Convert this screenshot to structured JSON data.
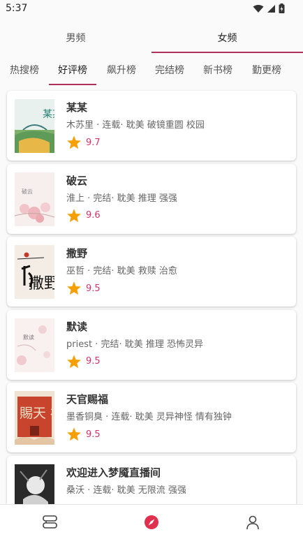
{
  "status_bar": {
    "time": "5:37"
  },
  "gender_tabs": [
    {
      "label": "男频",
      "active": false
    },
    {
      "label": "女频",
      "active": true
    }
  ],
  "rank_tabs": [
    {
      "label": "热搜榜",
      "active": false
    },
    {
      "label": "好评榜",
      "active": true
    },
    {
      "label": "飙升榜",
      "active": false
    },
    {
      "label": "完结榜",
      "active": false
    },
    {
      "label": "新书榜",
      "active": false
    },
    {
      "label": "勤更榜",
      "active": false
    }
  ],
  "books": [
    {
      "title": "某某",
      "meta": "木苏里 · 连载· 耽美 破镜重圆 校园",
      "score": "9.7"
    },
    {
      "title": "破云",
      "meta": "淮上 · 完结· 耽美 推理 强强",
      "score": "9.6"
    },
    {
      "title": "撒野",
      "meta": "巫哲 · 完结· 耽美 救赎 治愈",
      "score": "9.5"
    },
    {
      "title": "默读",
      "meta": "priest · 完结· 耽美 推理 恐怖灵异",
      "score": "9.5"
    },
    {
      "title": "天官赐福",
      "meta": "墨香铜臭 · 连载· 耽美 灵异神怪 情有独钟",
      "score": "9.5"
    },
    {
      "title": "欢迎进入梦魇直播间",
      "meta": "桑沃 · 连载· 耽美 无限流 强强",
      "score": ""
    }
  ],
  "covers": {
    "cover_1_text": "某某",
    "cover_2_text": "破云",
    "cover_3_text": "撒野",
    "cover_4_text": "默读",
    "cover_5_text": "賜天 福官"
  },
  "icons": {
    "wifi": "wifi-icon",
    "signal": "cell-signal-icon",
    "battery": "battery-icon",
    "star": "star-icon",
    "nav_bookshelf": "bookshelf-icon",
    "nav_discover": "compass-icon",
    "nav_profile": "person-icon"
  },
  "colors": {
    "accent": "#b0305a",
    "score": "#d4336b",
    "star": "#f5a000",
    "compass": "#e0304e"
  }
}
